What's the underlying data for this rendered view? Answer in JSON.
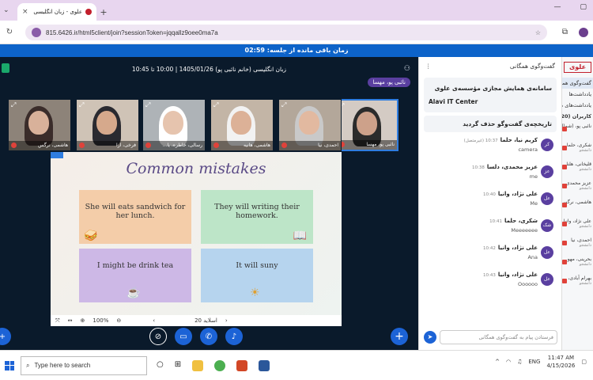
{
  "browser": {
    "tab_title": "علوی - زبان انگلیسی (خانم نا...",
    "new_tab_label": "+",
    "url": "815.6426.ir/html5client/join?sessionToken=jqqallz9oee0ma7a",
    "close_label": "×"
  },
  "session": {
    "timer_text": "زمان باقی مانده از جلسه: 02:59",
    "meeting_title": "زبان انگلیسی (خانم نائبی پو) 1405/01/26 | 10:00 تا 10:45",
    "speaker_tag": "نائبی پو، مهسا"
  },
  "participants": [
    {
      "name": "نائبی پو، مهسا",
      "active": true,
      "skin": "#cda18a",
      "hijab": "#2b2b2b",
      "bg": "#d4cbc4"
    },
    {
      "name": "احمدی، نیا",
      "active": false,
      "skin": "#e2b9a0",
      "hijab": "#c9c9c9",
      "bg": "#b3a79a"
    },
    {
      "name": "هاشمی، هانیه",
      "active": false,
      "skin": "#dcb197",
      "hijab": "#f2f2f2",
      "bg": "#c3b5a6"
    },
    {
      "name": "رسالی، خاطره، یا...",
      "active": false,
      "skin": "#e6c4ae",
      "hijab": "#ffffff",
      "bg": "#aeb3b7"
    },
    {
      "name": "فرخی، ارا",
      "active": false,
      "skin": "#d6a98c",
      "hijab": "#2a2a30",
      "bg": "#cfc3b6"
    },
    {
      "name": "هاشمی، نرگس",
      "active": false,
      "skin": "#d8b19a",
      "hijab": "#3a2c2a",
      "bg": "#8d8379"
    }
  ],
  "slide": {
    "title": "Common mistakes",
    "cards": [
      {
        "text": "She will eats sandwich for her lunch.",
        "icon": "🥪"
      },
      {
        "text": "They will writing their homework.",
        "icon": "📖"
      },
      {
        "text": "I might be drink tea",
        "icon": "☕"
      },
      {
        "text": "It will suny",
        "icon": "☀"
      }
    ],
    "page_label": "اسلاید 20",
    "zoom": "100%"
  },
  "chat": {
    "header": "گفت‌وگوی همگانی",
    "info_title": "سامانه‌ی همایش مجازی مؤسسه‌ی علوی",
    "info_sub": "Alavi IT Center",
    "cleared_notice": "تاریخچه‌ی گفت‌وگو حذف گردید",
    "input_placeholder": "فرستادن پیام به گفت‌وگوی همگانی",
    "messages": [
      {
        "avatar": "کر",
        "name": "کریم نیا، حلما",
        "time": "10:37",
        "extra": "(غیرمتصل)",
        "text": "camera"
      },
      {
        "avatar": "عز",
        "name": "عزیز محمدی، دلسا",
        "time": "10:38",
        "extra": "",
        "text": "me"
      },
      {
        "avatar": "عل",
        "name": "علی نژاد، وانیا",
        "time": "10:40",
        "extra": "",
        "text": "Me"
      },
      {
        "avatar": "شک",
        "name": "شکری، حلما",
        "time": "10:41",
        "extra": "",
        "text": "Meeeeeee"
      },
      {
        "avatar": "عل",
        "name": "علی نژاد، وانیا",
        "time": "10:42",
        "extra": "",
        "text": "Ana"
      },
      {
        "avatar": "عل",
        "name": "علی نژاد، وانیا",
        "time": "10:43",
        "extra": "",
        "text": "Oooooo"
      }
    ]
  },
  "sidebar": {
    "logo": "علوی",
    "items": [
      "گفت‌وگوی همگا...",
      "یادداشت‌ها",
      "یادداشت‌های همه..."
    ],
    "users_header": "کاربران (20)",
    "users": [
      {
        "name": "نائبی پو، (شما)",
        "role": ""
      },
      {
        "name": "شکری، حلما",
        "role": "دانشجو"
      },
      {
        "name": "قلیخانی، هلنا",
        "role": "دانشجو"
      },
      {
        "name": "عزیز محمدی...",
        "role": "دانشجو"
      },
      {
        "name": "هاشمی، نرگس",
        "role": ""
      },
      {
        "name": "علی نژاد، وانیا",
        "role": "دانشجو"
      },
      {
        "name": "احمدی، نیا",
        "role": "دانشجو"
      },
      {
        "name": "بحرینی، مهو...",
        "role": "دانشجو"
      },
      {
        "name": "بهرام آبادی، ...",
        "role": "دانشجو"
      }
    ]
  },
  "taskbar": {
    "search_placeholder": "Type here to search",
    "lang": "ENG",
    "time": "11:47 AM",
    "date": "4/15/2026"
  }
}
